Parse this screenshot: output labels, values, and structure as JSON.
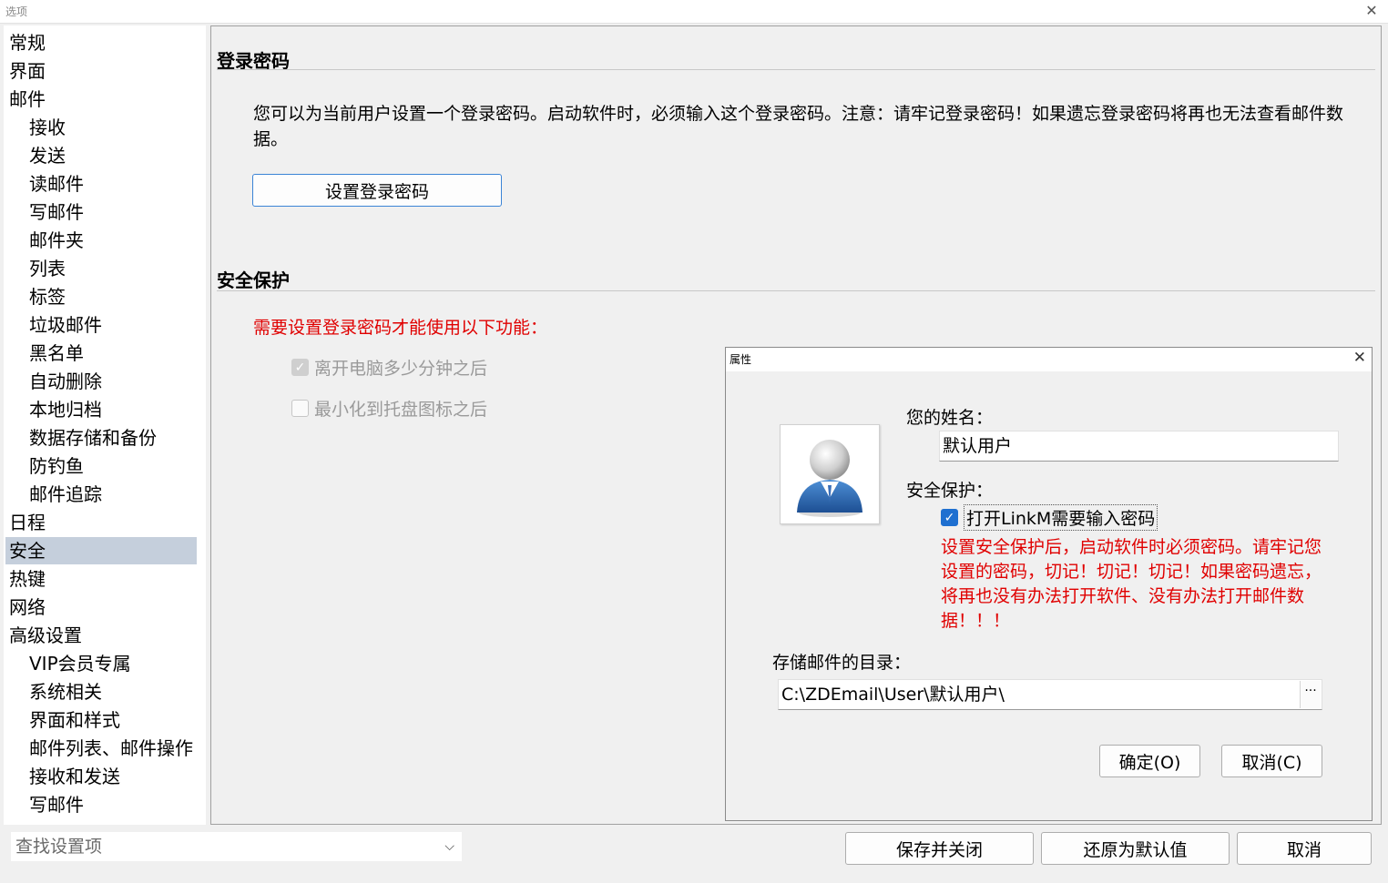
{
  "window": {
    "title": "选项",
    "close_glyph": "✕"
  },
  "sidebar": {
    "items": [
      {
        "label": "常规",
        "level": 1
      },
      {
        "label": "界面",
        "level": 1
      },
      {
        "label": "邮件",
        "level": 1
      },
      {
        "label": "接收",
        "level": 2
      },
      {
        "label": "发送",
        "level": 2
      },
      {
        "label": "读邮件",
        "level": 2
      },
      {
        "label": "写邮件",
        "level": 2
      },
      {
        "label": "邮件夹",
        "level": 2
      },
      {
        "label": "列表",
        "level": 2
      },
      {
        "label": "标签",
        "level": 2
      },
      {
        "label": "垃圾邮件",
        "level": 2
      },
      {
        "label": "黑名单",
        "level": 2
      },
      {
        "label": "自动删除",
        "level": 2
      },
      {
        "label": "本地归档",
        "level": 2
      },
      {
        "label": "数据存储和备份",
        "level": 2
      },
      {
        "label": "防钓鱼",
        "level": 2
      },
      {
        "label": "邮件追踪",
        "level": 2
      },
      {
        "label": "日程",
        "level": 1
      },
      {
        "label": "安全",
        "level": 1,
        "selected": true
      },
      {
        "label": "热键",
        "level": 1
      },
      {
        "label": "网络",
        "level": 1
      },
      {
        "label": "高级设置",
        "level": 1
      },
      {
        "label": "VIP会员专属",
        "level": 2
      },
      {
        "label": "系统相关",
        "level": 2
      },
      {
        "label": "界面和样式",
        "level": 2
      },
      {
        "label": "邮件列表、邮件操作",
        "level": 2
      },
      {
        "label": "接收和发送",
        "level": 2
      },
      {
        "label": "写邮件",
        "level": 2
      }
    ],
    "selected_color": "#c5cfdc"
  },
  "login_password": {
    "heading": "登录密码",
    "description": "您可以为当前用户设置一个登录密码。启动软件时，必须输入这个登录密码。注意：请牢记登录密码！如果遗忘登录密码将再也无法查看邮件数据。",
    "set_button": "设置登录密码"
  },
  "security": {
    "heading": "安全保护",
    "notice": "需要设置登录密码才能使用以下功能：",
    "notice_color": "#e00000",
    "options": [
      {
        "label": "离开电脑多少分钟之后",
        "checked": true,
        "disabled": true
      },
      {
        "label": "最小化到托盘图标之后",
        "checked": false,
        "disabled": true
      }
    ]
  },
  "dialog": {
    "title": "属性",
    "close_glyph": "✕",
    "name_label": "您的姓名：",
    "name_value": "默认用户",
    "security_label": "安全保护：",
    "password_checkbox": {
      "label": "打开LinkM需要输入密码",
      "checked": true
    },
    "warning": "设置安全保护后，启动软件时必须密码。请牢记您设置的密码，切记！切记！切记！如果密码遗忘，将再也没有办法打开软件、没有办法打开邮件数据！！！",
    "dir_label": "存储邮件的目录：",
    "dir_value": "C:\\ZDEmail\\User\\默认用户\\",
    "browse_label": "···",
    "ok_button": "确定(O)",
    "cancel_button": "取消(C)"
  },
  "bottom": {
    "search_placeholder": "查找设置项",
    "save_close": "保存并关闭",
    "restore_default": "还原为默认值",
    "cancel": "取消"
  }
}
